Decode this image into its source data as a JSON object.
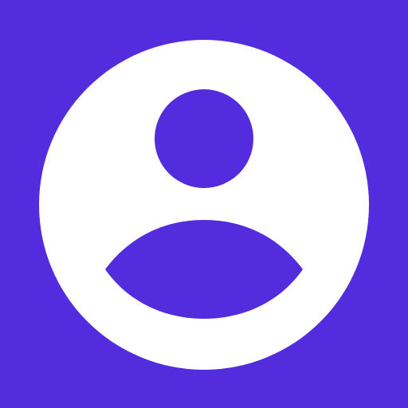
{
  "icon": {
    "name": "user-avatar-icon",
    "colors": {
      "background": "#532DDD",
      "foreground": "#FFFFFF"
    }
  }
}
